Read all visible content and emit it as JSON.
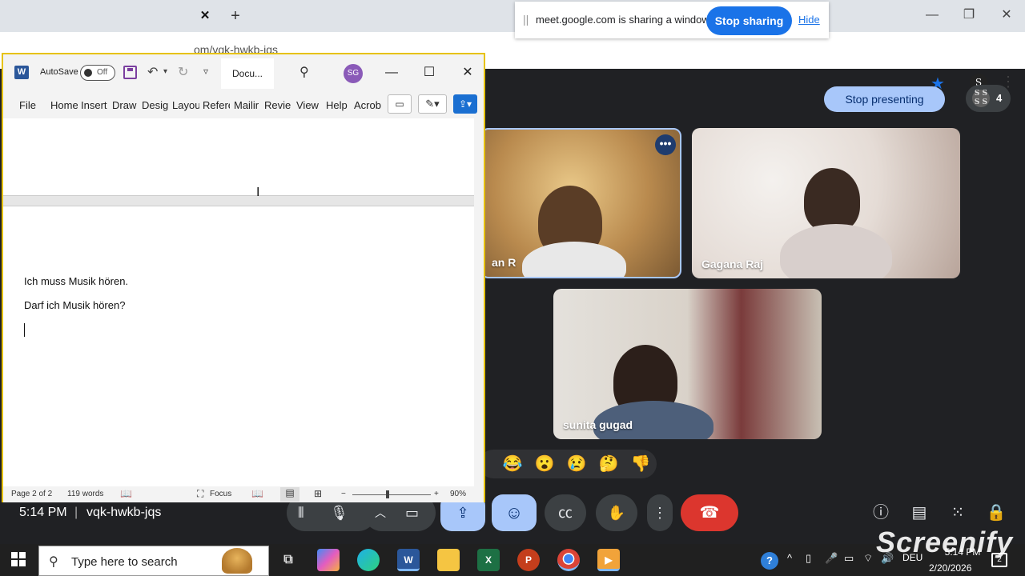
{
  "chrome": {
    "tab_close": "✕",
    "new_tab": "+",
    "url_partial": "om/vqk-hwkb-jqs"
  },
  "share_bar": {
    "message": "meet.google.com is sharing a window.",
    "stop_sharing": "Stop sharing",
    "hide": "Hide"
  },
  "meet": {
    "stop_presenting": "Stop presenting",
    "participant_count": "4",
    "tiles": [
      {
        "name": "an R"
      },
      {
        "name": "Gagana Raj"
      },
      {
        "name": "sunita gugad"
      }
    ],
    "reactions": [
      "😂",
      "😮",
      "😢",
      "🤔",
      "👎"
    ],
    "time": "5:14 PM",
    "separator": "|",
    "meeting_code": "vqk-hwkb-jqs"
  },
  "word": {
    "autosave_label": "AutoSave",
    "autosave_state": "Off",
    "doc_title": "Docu...",
    "avatar_initials": "SG",
    "ribbon_tabs": [
      "File",
      "Home",
      "Insert",
      "Draw",
      "Desig",
      "Layou",
      "Refere",
      "Mailir",
      "Revie",
      "View",
      "Help",
      "Acrob"
    ],
    "lines": [
      "Ich muss Musik hören.",
      "Darf ich Musik hören?"
    ],
    "status": {
      "page": "Page 2 of 2",
      "words": "119 words",
      "focus": "Focus",
      "zoom": "90%",
      "zoom_minus": "−",
      "zoom_plus": "+"
    }
  },
  "taskbar": {
    "search_placeholder": "Type here to search",
    "language": "DEU",
    "time": "5:14 PM",
    "date": "2/20/2026"
  },
  "watermark": "Screenify"
}
